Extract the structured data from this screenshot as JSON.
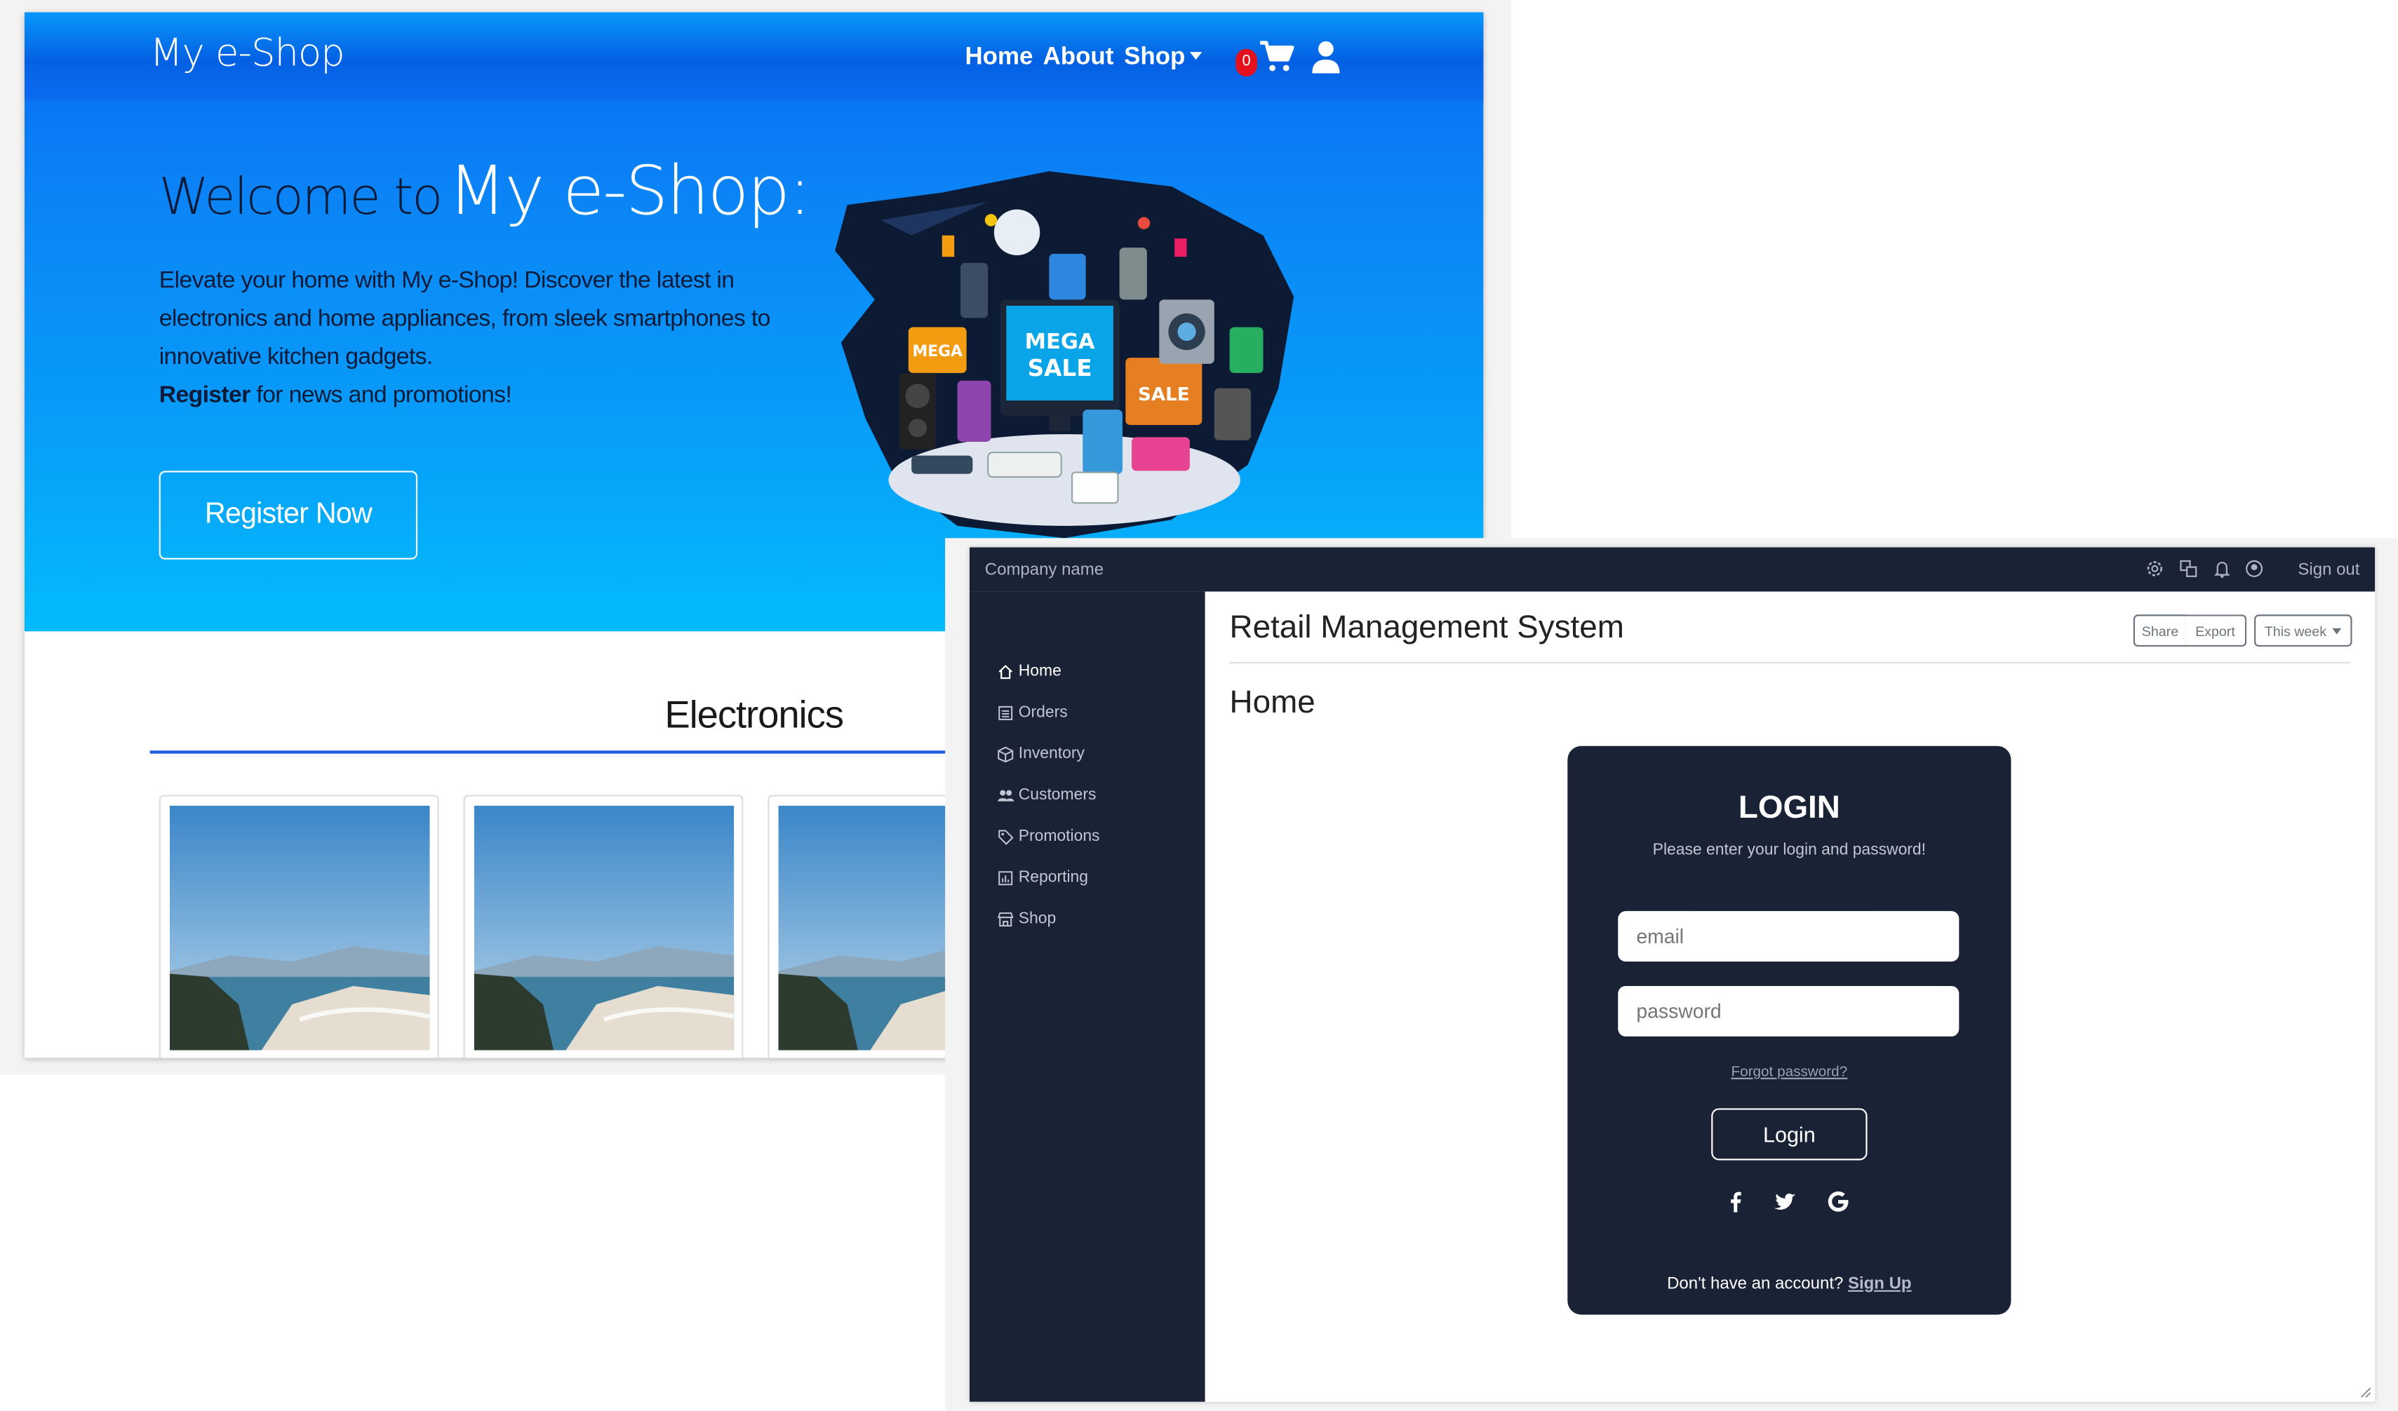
{
  "eshop": {
    "brand": "My e-Shop",
    "nav": {
      "home": "Home",
      "about": "About",
      "shop": "Shop"
    },
    "cart_count": "0",
    "hero": {
      "title_prefix": "Welcome to",
      "title_brand": "My e-Shop:",
      "text": "Elevate your home with My e-Shop! Discover the latest in electronics and home appliances, from sleek smartphones to innovative kitchen gadgets.",
      "register_bold": "Register",
      "register_rest": " for news and promotions!",
      "button": "Register Now",
      "art_labels": {
        "mega_left": "MEGA",
        "mega_sale_1": "MEGA",
        "mega_sale_2": "SALE",
        "sale": "SALE"
      }
    },
    "section_title": "Electronics",
    "colors": {
      "hero_top": "#0a66ea",
      "hero_bottom": "#03bbfb",
      "rule": "#1f5ce0",
      "badge": "#e3101d"
    }
  },
  "retail": {
    "company": "Company name",
    "signout": "Sign out",
    "topbar_icons": [
      "gear-icon",
      "translate-icon",
      "bell-icon",
      "user-circle-icon"
    ],
    "sidebar": [
      {
        "label": "Home",
        "icon": "house-icon"
      },
      {
        "label": "Orders",
        "icon": "list-icon"
      },
      {
        "label": "Inventory",
        "icon": "box-icon"
      },
      {
        "label": "Customers",
        "icon": "people-icon"
      },
      {
        "label": "Promotions",
        "icon": "tag-icon"
      },
      {
        "label": "Reporting",
        "icon": "chart-icon"
      },
      {
        "label": "Shop",
        "icon": "shop-icon"
      }
    ],
    "title": "Retail Management System",
    "buttons": {
      "share": "Share",
      "export": "Export",
      "period": "This week"
    },
    "page_heading": "Home",
    "login": {
      "title": "LOGIN",
      "subtitle": "Please enter your login and password!",
      "email_placeholder": "email",
      "password_placeholder": "password",
      "forgot": "Forgot password?",
      "button": "Login",
      "social": [
        "facebook-icon",
        "twitter-icon",
        "google-icon"
      ],
      "signup_prompt": "Don't have an account? ",
      "signup_link": "Sign Up"
    },
    "colors": {
      "dark": "#1a2236"
    }
  }
}
